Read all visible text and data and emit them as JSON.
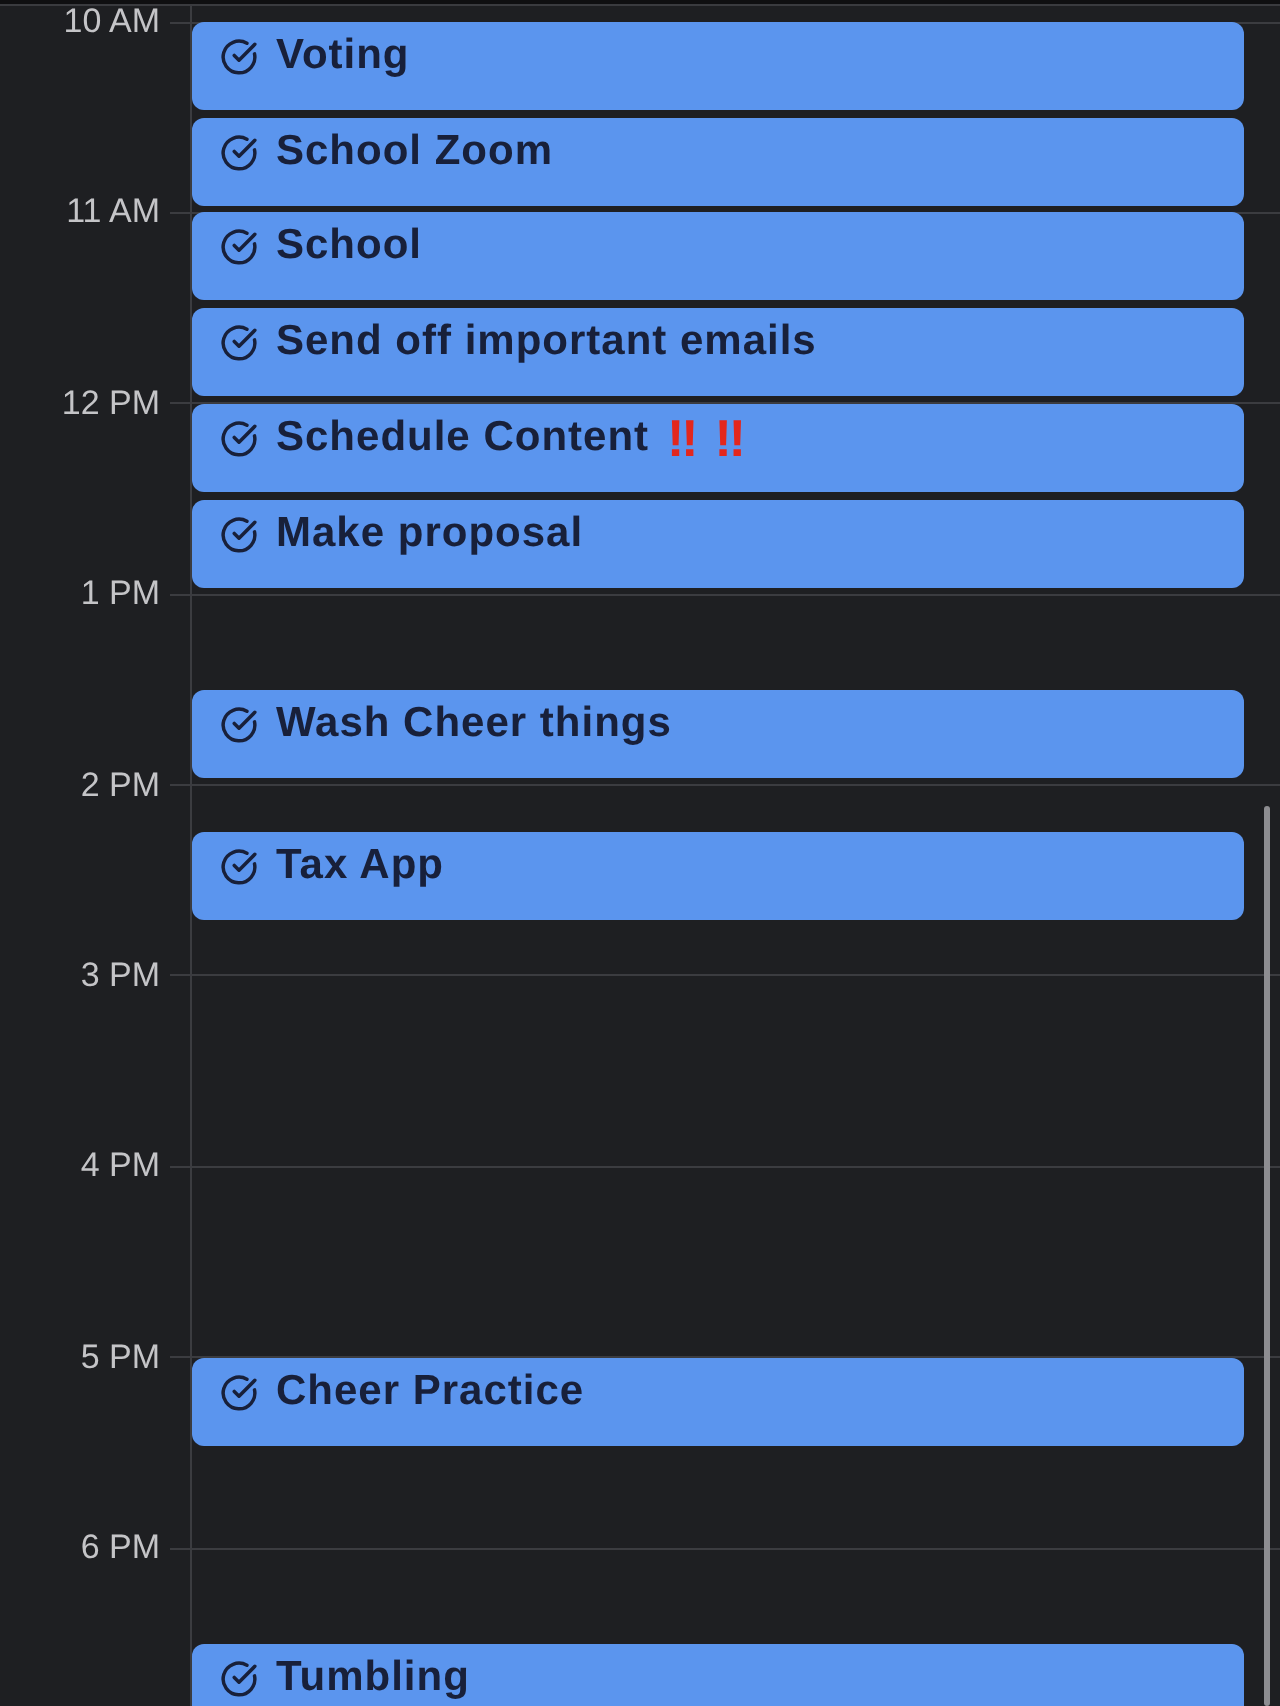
{
  "hours": [
    {
      "label": "10 AM"
    },
    {
      "label": "11 AM"
    },
    {
      "label": "12 PM"
    },
    {
      "label": "1 PM"
    },
    {
      "label": "2 PM"
    },
    {
      "label": "3 PM"
    },
    {
      "label": "4 PM"
    },
    {
      "label": "5 PM"
    },
    {
      "label": "6 PM"
    }
  ],
  "events": [
    {
      "title": "Voting"
    },
    {
      "title": "School Zoom"
    },
    {
      "title": "School"
    },
    {
      "title": "Send off important emails"
    },
    {
      "title": "Schedule Content",
      "marks": "‼‼"
    },
    {
      "title": "Make proposal"
    },
    {
      "title": "Wash Cheer things"
    },
    {
      "title": "Tax App"
    },
    {
      "title": "Cheer Practice"
    },
    {
      "title": "Tumbling"
    }
  ]
}
